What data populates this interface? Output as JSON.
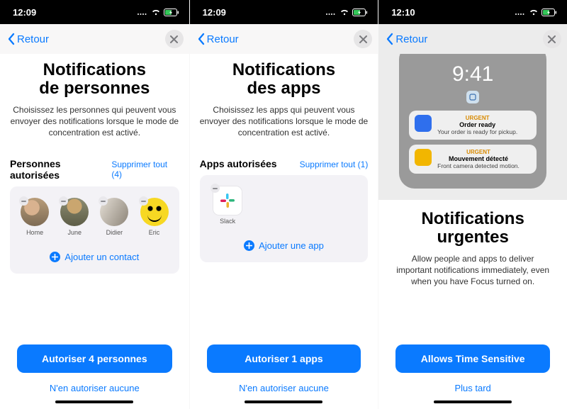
{
  "phones": [
    {
      "status": {
        "time": "12:09"
      },
      "nav": {
        "back": "Retour"
      },
      "title1": "Notifications",
      "title2": "de personnes",
      "subtitle": "Choisissez les personnes qui peuvent vous envoyer des notifications lorsque le mode de concentration est activé.",
      "section_label": "Personnes autorisées",
      "section_action": "Supprimer tout (4)",
      "people": [
        {
          "name": "Home"
        },
        {
          "name": "June"
        },
        {
          "name": "Didier"
        },
        {
          "name": "Eric"
        }
      ],
      "add_label": "Ajouter un contact",
      "primary": "Autoriser 4 personnes",
      "secondary": "N'en autoriser aucune"
    },
    {
      "status": {
        "time": "12:09"
      },
      "nav": {
        "back": "Retour"
      },
      "title1": "Notifications",
      "title2": "des apps",
      "subtitle": "Choisissez les apps qui peuvent vous envoyer des notifications lorsque le mode de concentration est activé.",
      "section_label": "Apps autorisées",
      "section_action": "Supprimer tout (1)",
      "apps": [
        {
          "name": "Slack"
        }
      ],
      "add_label": "Ajouter une app",
      "primary": "Autoriser 1 apps",
      "secondary": "N'en autoriser aucune"
    },
    {
      "status": {
        "time": "12:10"
      },
      "nav": {
        "back": "Retour"
      },
      "mock": {
        "time": "9:41",
        "notifs": [
          {
            "tag": "URGENT",
            "title": "Order ready",
            "body": "Your order is ready for pickup.",
            "icon_color": "#2f6fed"
          },
          {
            "tag": "URGENT",
            "title": "Mouvement détecté",
            "body": "Front camera detected motion.",
            "icon_color": "#f2b600"
          }
        ]
      },
      "title1": "Notifications",
      "title2": "urgentes",
      "subtitle": "Allow people and apps to deliver important notifications immediately, even when you have Focus turned on.",
      "primary": "Allows Time Sensitive",
      "secondary": "Plus tard"
    }
  ]
}
